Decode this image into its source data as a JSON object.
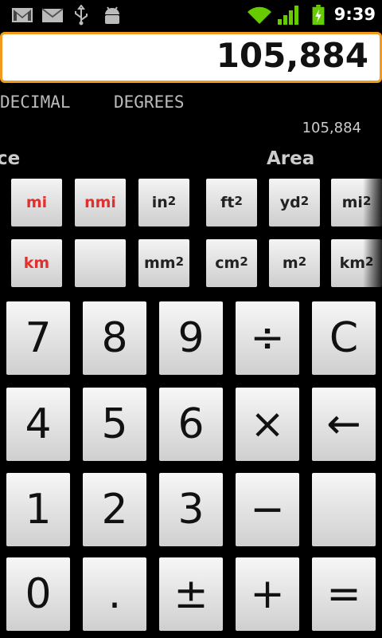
{
  "status_bar": {
    "time": "9:39",
    "icons": [
      "gmail-icon",
      "email-icon",
      "usb-icon",
      "android-debug-icon",
      "wifi-icon",
      "signal-icon",
      "battery-charging-icon"
    ]
  },
  "display": {
    "value": "105,884"
  },
  "modes": {
    "left": "DECIMAL",
    "right": "DEGREES"
  },
  "result": "105,884",
  "categories": {
    "left_partial": "ce",
    "right": "Area"
  },
  "unit_buttons": {
    "row1": [
      {
        "base": "mi",
        "sup": ""
      },
      {
        "base": "nmi",
        "sup": ""
      },
      {
        "base": "in",
        "sup": "2"
      },
      {
        "base": "ft",
        "sup": "2"
      },
      {
        "base": "yd",
        "sup": "2"
      },
      {
        "base": "mi",
        "sup": "2"
      }
    ],
    "row2": [
      {
        "base": "km",
        "sup": ""
      },
      {
        "base": "",
        "sup": ""
      },
      {
        "base": "mm",
        "sup": "2"
      },
      {
        "base": "cm",
        "sup": "2"
      },
      {
        "base": "m",
        "sup": "2"
      },
      {
        "base": "km",
        "sup": "2"
      }
    ]
  },
  "keys": {
    "row1": [
      "7",
      "8",
      "9",
      "÷",
      "C"
    ],
    "row2": [
      "4",
      "5",
      "6",
      "×",
      "←"
    ],
    "row3": [
      "1",
      "2",
      "3",
      "−",
      ""
    ],
    "row4": [
      "0",
      ".",
      "±",
      "+",
      "="
    ]
  },
  "colors": {
    "accent": "#f39a1c",
    "unit_highlight": "#e03030",
    "battery": "#66cc00",
    "signal": "#66cc00"
  }
}
